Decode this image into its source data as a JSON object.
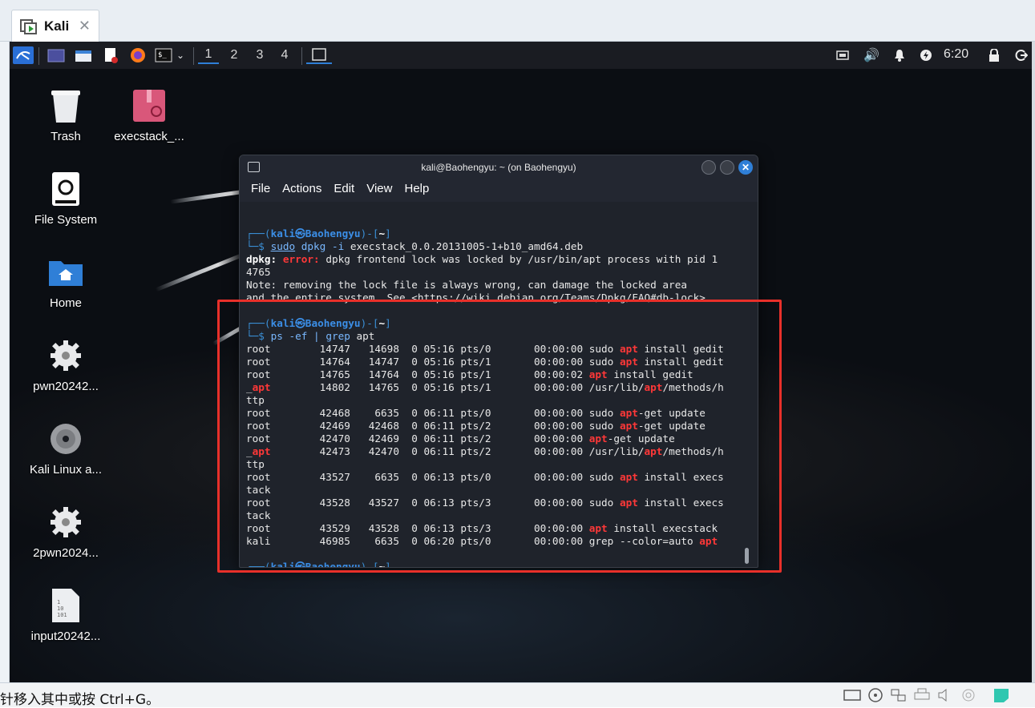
{
  "host": {
    "tab_label": "Kali",
    "status_message": "针移入其中或按 Ctrl+G。"
  },
  "panel": {
    "workspaces": [
      "1",
      "2",
      "3",
      "4"
    ],
    "clock": "6:20"
  },
  "desktop_icons": [
    {
      "label": "Trash"
    },
    {
      "label": "execstack_..."
    },
    {
      "label": "File System"
    },
    {
      "label": "Home"
    },
    {
      "label": "pwn20242..."
    },
    {
      "label": "Kali Linux a..."
    },
    {
      "label": "2pwn2024..."
    },
    {
      "label": "input20242..."
    }
  ],
  "terminal": {
    "title": "kali@Baohengyu: ~ (on Baohengyu)",
    "menu": [
      "File",
      "Actions",
      "Edit",
      "View",
      "Help"
    ],
    "prompt_user": "kali",
    "prompt_host": "Baohengyu",
    "prompt_dir": "~",
    "cmd1": {
      "sudo": "sudo",
      "rest": "dpkg -i execstack_0.0.20131005-1+b10_amd64.deb"
    },
    "dpkg_label": "dpkg:",
    "error_label": "error:",
    "error_text": "dpkg frontend lock was locked by /usr/bin/apt process with pid 1",
    "error_text2": "4765",
    "note1": "Note: removing the lock file is always wrong, can damage the locked area",
    "note2": "and the entire system. See <https://wiki.debian.org/Teams/Dpkg/FAQ#db-lock>.",
    "cmd2": {
      "ps": "ps -ef",
      "pipe": "|",
      "grep": "grep",
      "arg": "apt"
    },
    "ps_rows": [
      {
        "user": "root",
        "pid": "14747",
        "ppid": "14698",
        "c": "0",
        "stime": "05:16",
        "tty": "pts/0",
        "time": "00:00:00",
        "cmd": "sudo apt install gedit"
      },
      {
        "user": "root",
        "pid": "14764",
        "ppid": "14747",
        "c": "0",
        "stime": "05:16",
        "tty": "pts/1",
        "time": "00:00:00",
        "cmd": "sudo apt install gedit"
      },
      {
        "user": "root",
        "pid": "14765",
        "ppid": "14764",
        "c": "0",
        "stime": "05:16",
        "tty": "pts/1",
        "time": "00:00:02",
        "cmd": "apt install gedit"
      },
      {
        "user": "_apt",
        "pid": "14802",
        "ppid": "14765",
        "c": "0",
        "stime": "05:16",
        "tty": "pts/1",
        "time": "00:00:00",
        "cmd": "/usr/lib/apt/methods/http"
      },
      {
        "user": "root",
        "pid": "42468",
        "ppid": "6635",
        "c": "0",
        "stime": "06:11",
        "tty": "pts/0",
        "time": "00:00:00",
        "cmd": "sudo apt-get update"
      },
      {
        "user": "root",
        "pid": "42469",
        "ppid": "42468",
        "c": "0",
        "stime": "06:11",
        "tty": "pts/2",
        "time": "00:00:00",
        "cmd": "sudo apt-get update"
      },
      {
        "user": "root",
        "pid": "42470",
        "ppid": "42469",
        "c": "0",
        "stime": "06:11",
        "tty": "pts/2",
        "time": "00:00:00",
        "cmd": "apt-get update"
      },
      {
        "user": "_apt",
        "pid": "42473",
        "ppid": "42470",
        "c": "0",
        "stime": "06:11",
        "tty": "pts/2",
        "time": "00:00:00",
        "cmd": "/usr/lib/apt/methods/http"
      },
      {
        "user": "root",
        "pid": "43527",
        "ppid": "6635",
        "c": "0",
        "stime": "06:13",
        "tty": "pts/0",
        "time": "00:00:00",
        "cmd": "sudo apt install execstack"
      },
      {
        "user": "root",
        "pid": "43528",
        "ppid": "43527",
        "c": "0",
        "stime": "06:13",
        "tty": "pts/3",
        "time": "00:00:00",
        "cmd": "sudo apt install execstack"
      },
      {
        "user": "root",
        "pid": "43529",
        "ppid": "43528",
        "c": "0",
        "stime": "06:13",
        "tty": "pts/3",
        "time": "00:00:00",
        "cmd": "apt install execstack"
      },
      {
        "user": "kali",
        "pid": "46985",
        "ppid": "6635",
        "c": "0",
        "stime": "06:20",
        "tty": "pts/0",
        "time": "00:00:00",
        "cmd": "grep --color=auto apt"
      }
    ]
  },
  "colors": {
    "accent": "#2f7fd7",
    "error": "#ff3838",
    "highlight": "#e8302a"
  }
}
